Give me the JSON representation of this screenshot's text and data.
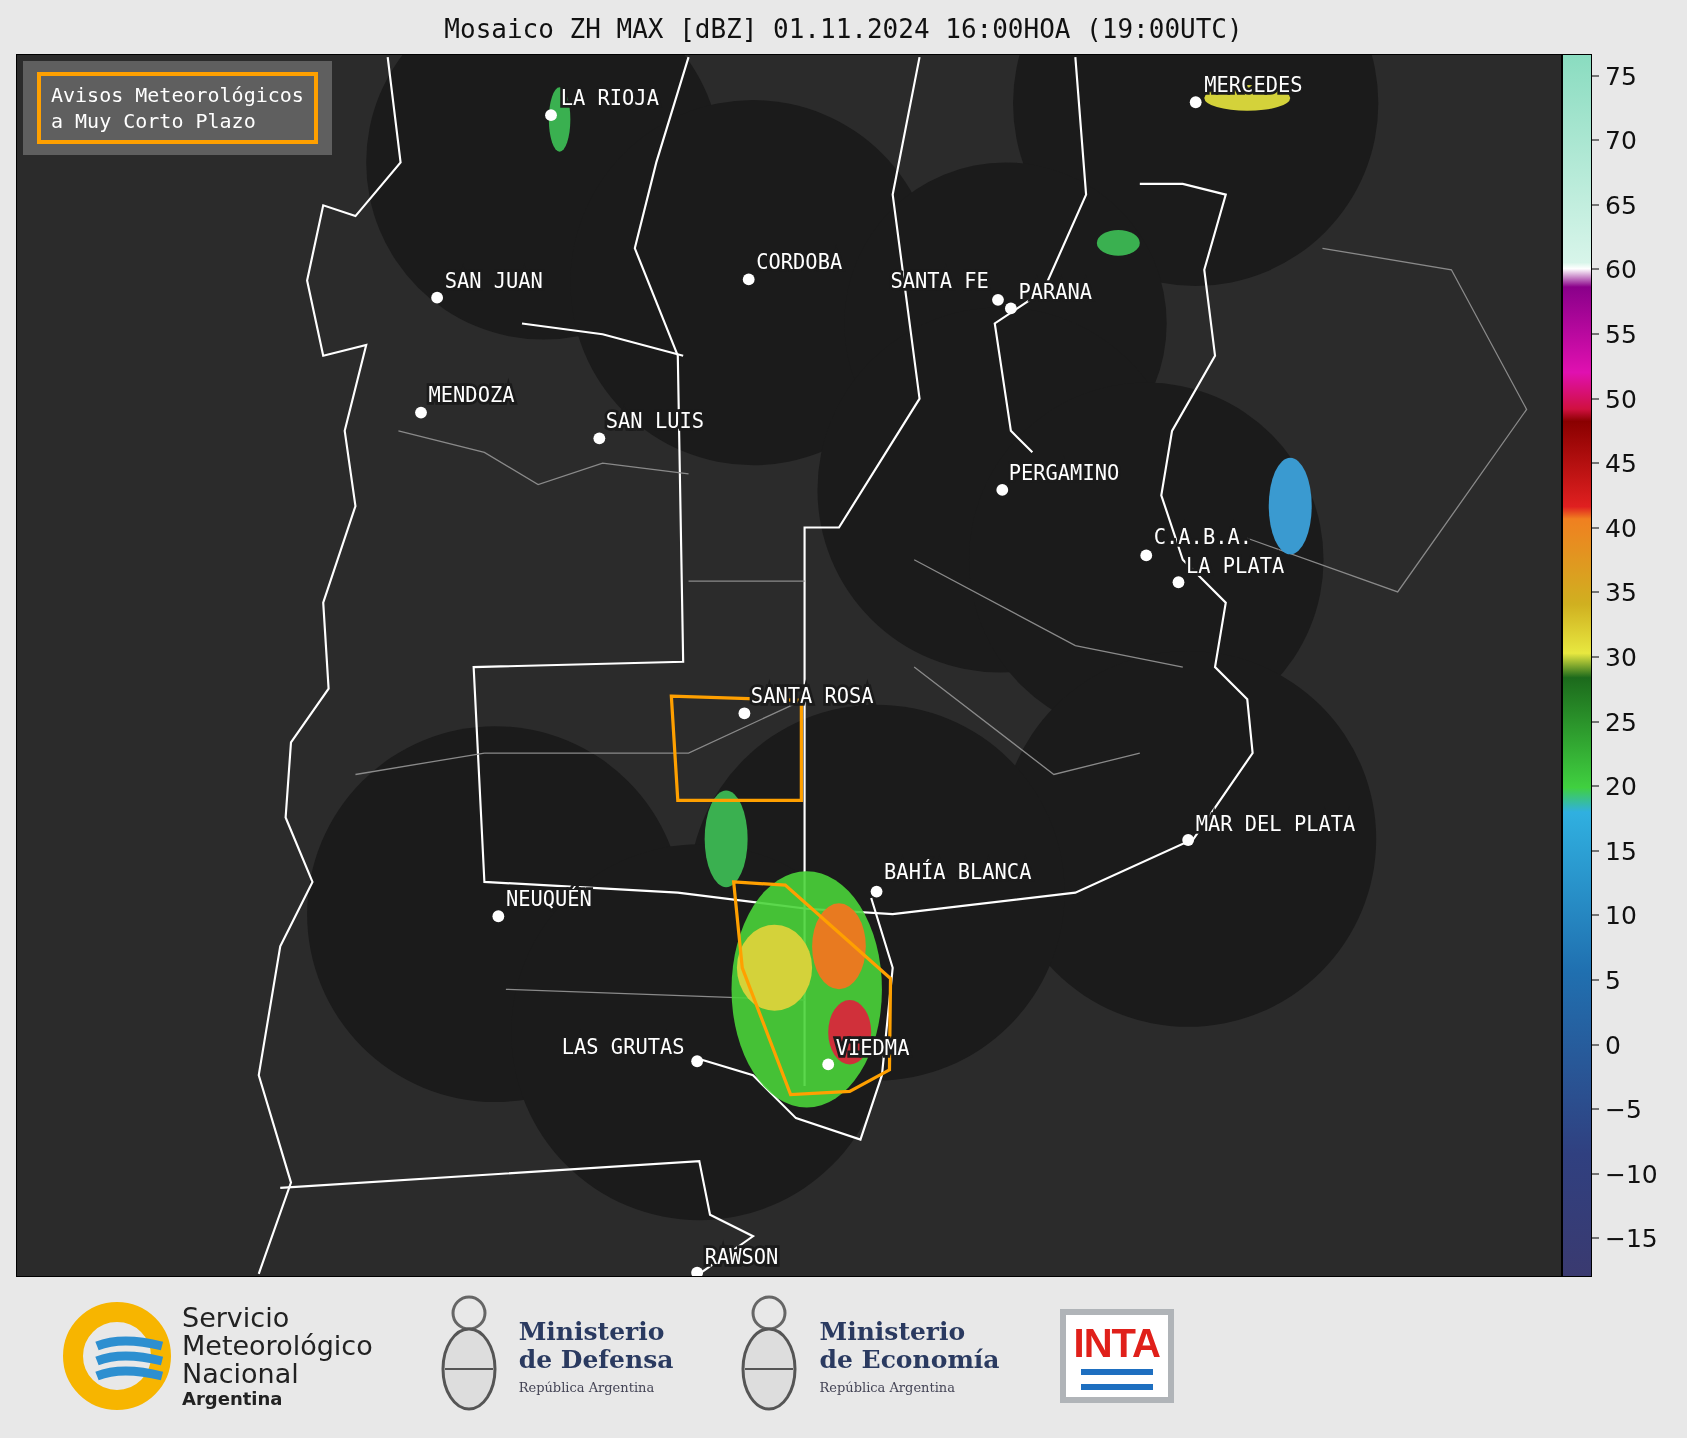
{
  "title": "Mosaico ZH MAX [dBZ] 01.11.2024 16:00HOA (19:00UTC)",
  "legend_box": {
    "lines": [
      "Avisos Meteorológicos",
      "a Muy Corto Plazo"
    ]
  },
  "cities": [
    {
      "name": "LA RIOJA"
    },
    {
      "name": "SAN JUAN"
    },
    {
      "name": "CORDOBA"
    },
    {
      "name": "SANTA FE"
    },
    {
      "name": "PARANA"
    },
    {
      "name": "MENDOZA"
    },
    {
      "name": "SAN LUIS"
    },
    {
      "name": "MERCEDES"
    },
    {
      "name": "PERGAMINO"
    },
    {
      "name": "C.A.B.A."
    },
    {
      "name": "LA PLATA"
    },
    {
      "name": "SANTA ROSA"
    },
    {
      "name": "MAR DEL PLATA"
    },
    {
      "name": "BAHÍA BLANCA"
    },
    {
      "name": "NEUQUÉN"
    },
    {
      "name": "LAS GRUTAS"
    },
    {
      "name": "VIEDMA"
    },
    {
      "name": "RAWSON"
    }
  ],
  "colorbar": {
    "ticks": [
      "75",
      "70",
      "65",
      "60",
      "55",
      "50",
      "45",
      "40",
      "35",
      "30",
      "25",
      "20",
      "15",
      "10",
      "5",
      "0",
      "−5",
      "−10",
      "−15"
    ]
  },
  "logos": [
    {
      "kind": "smn",
      "lines": [
        "Servicio",
        "Meteorológico",
        "Nacional"
      ],
      "sub": "Argentina"
    },
    {
      "kind": "ministry",
      "lines": [
        "Ministerio",
        "de Defensa"
      ],
      "sub": "República Argentina"
    },
    {
      "kind": "ministry",
      "lines": [
        "Ministerio",
        "de Economía"
      ],
      "sub": "República Argentina"
    },
    {
      "kind": "inta",
      "text": "INTA"
    }
  ]
}
